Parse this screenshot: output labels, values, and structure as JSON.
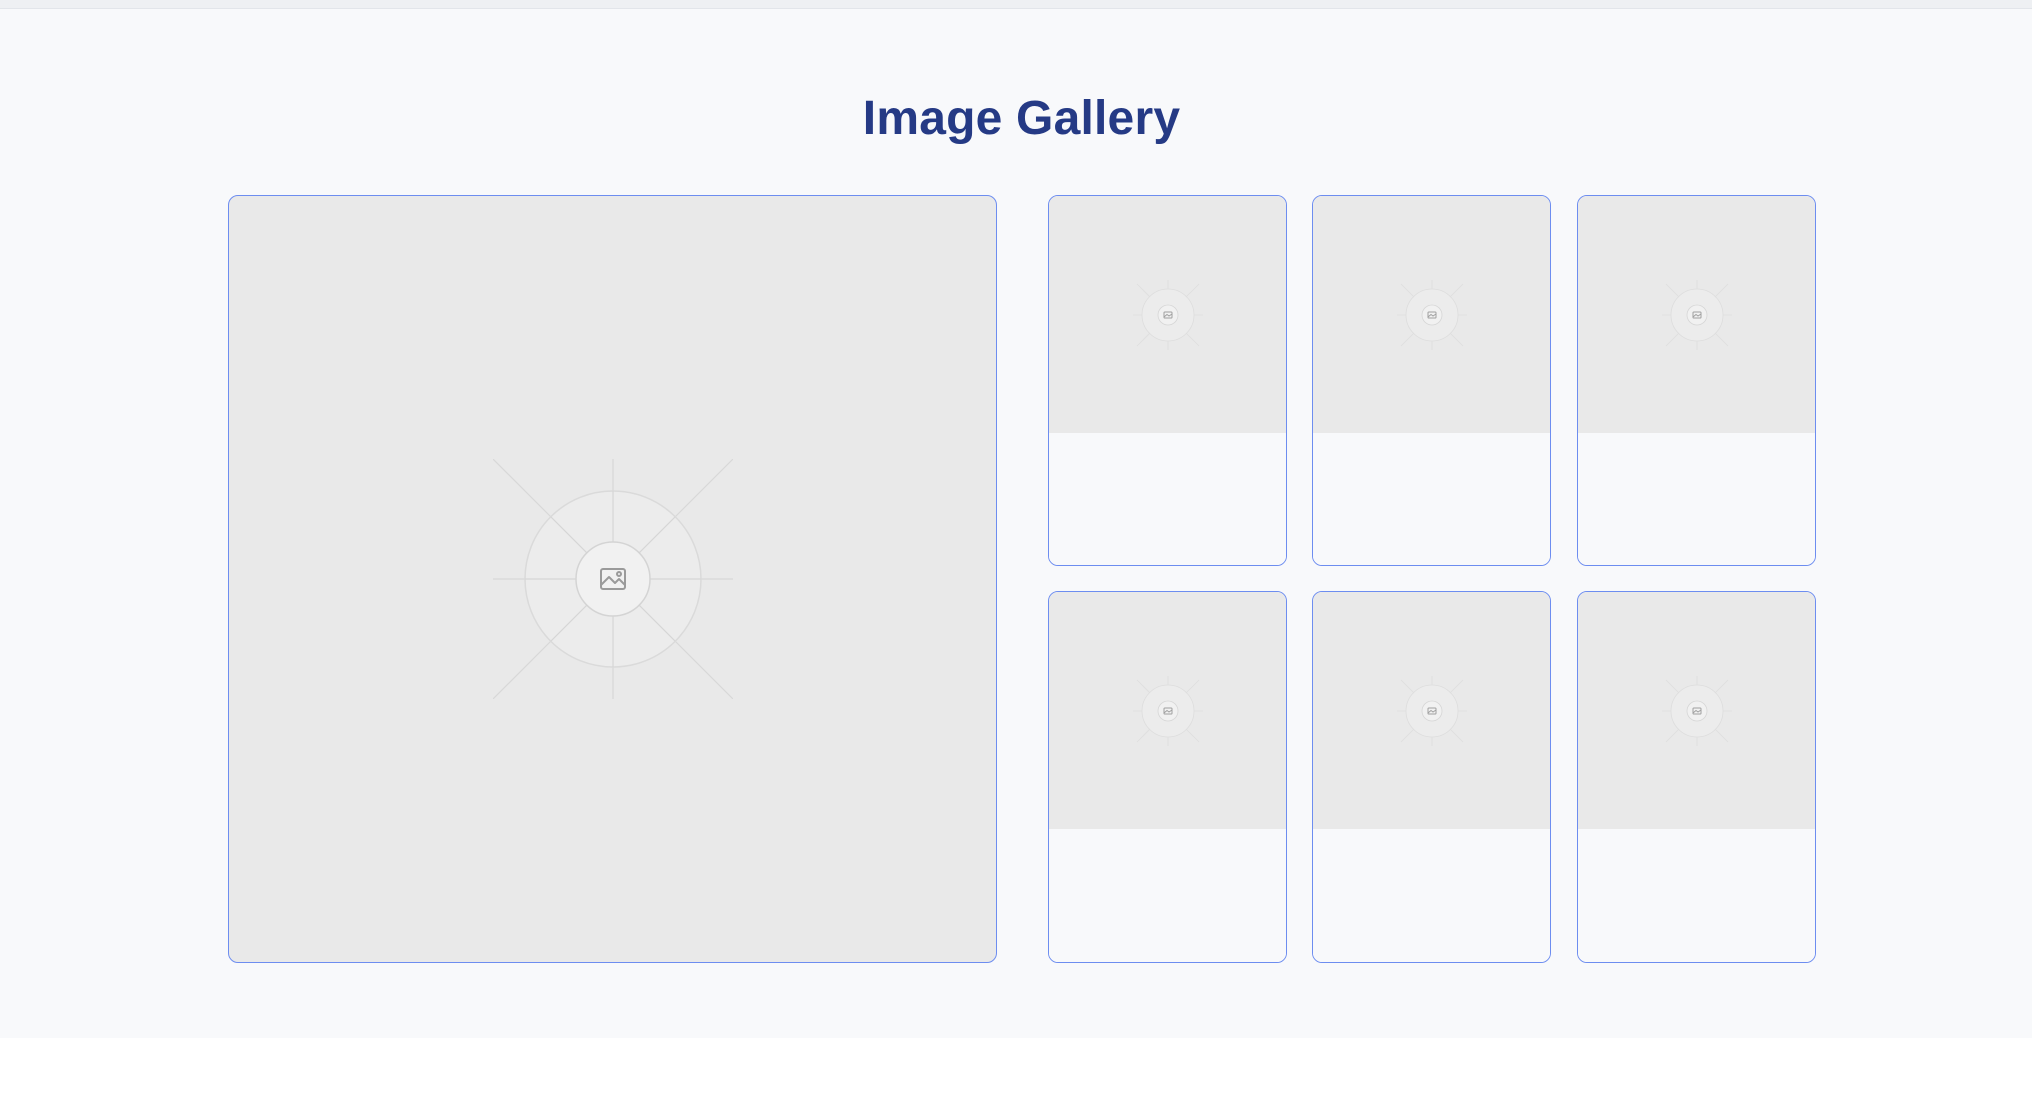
{
  "gallery": {
    "title": "Image Gallery",
    "featured": {
      "icon": "image-icon"
    },
    "thumbnails": [
      {
        "icon": "image-icon"
      },
      {
        "icon": "image-icon"
      },
      {
        "icon": "image-icon"
      },
      {
        "icon": "image-icon"
      },
      {
        "icon": "image-icon"
      },
      {
        "icon": "image-icon"
      }
    ]
  },
  "colors": {
    "title": "#253a85",
    "card_border": "#6d8df0",
    "placeholder_bg": "#e9e9e9",
    "page_bg": "#f8f9fb"
  }
}
